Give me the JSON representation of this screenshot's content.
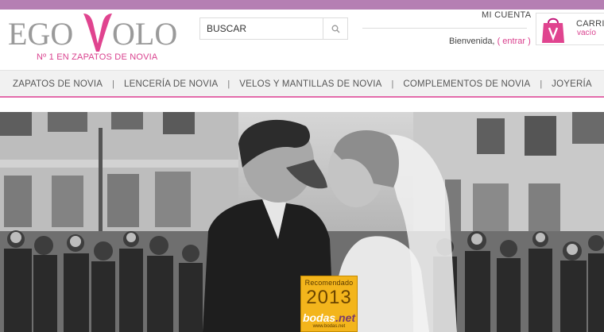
{
  "brand": {
    "logo_left": "EGO",
    "logo_right": "OLO",
    "tagline": "Nº 1 EN ZAPATOS DE NOVIA",
    "accent_color": "#d9418e",
    "topbar_color": "#b57fb3"
  },
  "search": {
    "placeholder": "BUSCAR",
    "icon": "search-icon"
  },
  "account": {
    "title": "MI CUENTA",
    "welcome": "Bienvenida,",
    "login_open": "( ",
    "login_label": "entrar",
    "login_close": " )"
  },
  "cart": {
    "title": "CARRITO",
    "status": "vacío",
    "icon": "shopping-bag-icon"
  },
  "nav": {
    "items": [
      {
        "label": "ZAPATOS DE NOVIA"
      },
      {
        "label": "LENCERÍA DE NOVIA"
      },
      {
        "label": "VELOS Y MANTILLAS DE NOVIA"
      },
      {
        "label": "COMPLEMENTOS DE NOVIA"
      },
      {
        "label": "JOYERÍA"
      }
    ],
    "separator": "|"
  },
  "badge": {
    "top": "Recomendado",
    "year": "2013",
    "brand_main": "bodas",
    "brand_accent": ".net",
    "url": "www.bodas.net"
  }
}
